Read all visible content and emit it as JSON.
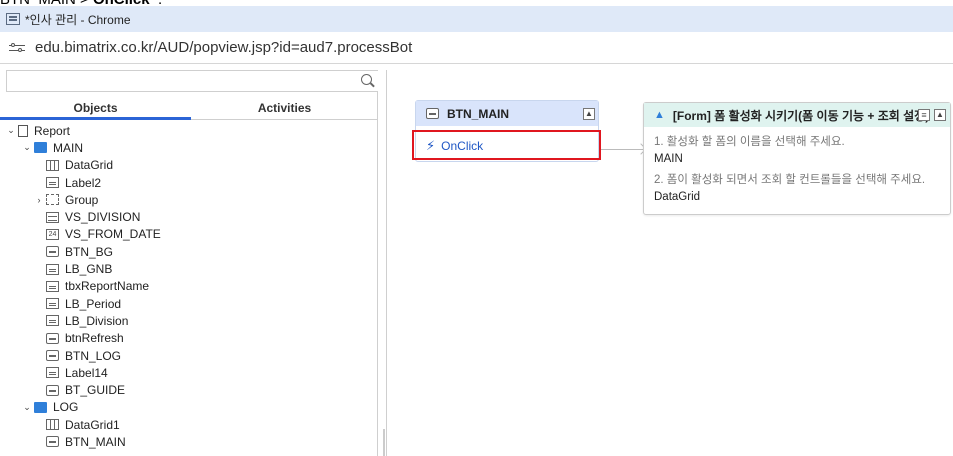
{
  "caption": {
    "prefix": "BTN_MAIN > ",
    "bold": "OnClick",
    "suffix": "  ."
  },
  "window": {
    "title": "*인사 관리 - Chrome"
  },
  "address": {
    "url": "edu.bimatrix.co.kr/AUD/popview.jsp?id=aud7.processBot"
  },
  "tabs": {
    "objects": "Objects",
    "activities": "Activities"
  },
  "tree": [
    {
      "label": "Report",
      "icon": "doc",
      "level": 0,
      "chevron": "down"
    },
    {
      "label": "MAIN",
      "icon": "folder",
      "level": 1,
      "chevron": "down"
    },
    {
      "label": "DataGrid",
      "icon": "grid",
      "level": 2
    },
    {
      "label": "Label2",
      "icon": "label",
      "level": 2
    },
    {
      "label": "Group",
      "icon": "grp",
      "level": 2,
      "chevron": "right"
    },
    {
      "label": "VS_DIVISION",
      "icon": "combo",
      "level": 2
    },
    {
      "label": "VS_FROM_DATE",
      "icon": "date",
      "level": 2
    },
    {
      "label": "BTN_BG",
      "icon": "btn",
      "level": 2
    },
    {
      "label": "LB_GNB",
      "icon": "label",
      "level": 2
    },
    {
      "label": "tbxReportName",
      "icon": "label",
      "level": 2
    },
    {
      "label": "LB_Period",
      "icon": "label",
      "level": 2
    },
    {
      "label": "LB_Division",
      "icon": "label",
      "level": 2
    },
    {
      "label": "btnRefresh",
      "icon": "btn",
      "level": 2
    },
    {
      "label": "BTN_LOG",
      "icon": "btn",
      "level": 2
    },
    {
      "label": "Label14",
      "icon": "label",
      "level": 2
    },
    {
      "label": "BT_GUIDE",
      "icon": "btn",
      "level": 2
    },
    {
      "label": "LOG",
      "icon": "folder",
      "level": 1,
      "chevron": "down"
    },
    {
      "label": "DataGrid1",
      "icon": "grid",
      "level": 2
    },
    {
      "label": "BTN_MAIN",
      "icon": "btn",
      "level": 2
    }
  ],
  "object_node": {
    "title": "BTN_MAIN",
    "event": "OnClick"
  },
  "action_node": {
    "title": "[Form] 폼 활성화 시키기(폼 이동 기능 + 조회 설정)",
    "q1": "1. 활성화 할 폼의 이름을 선택해 주세요.",
    "v1": "MAIN",
    "q2": "2. 폼이 활성화 되면서 조회 할 컨트롤들을 선택해 주세요.",
    "v2": "DataGrid"
  },
  "colors": {
    "accent": "#2b64d6",
    "highlight": "#e0161f",
    "node_header": "#d9e4fb",
    "action_header": "#dff3ef"
  }
}
